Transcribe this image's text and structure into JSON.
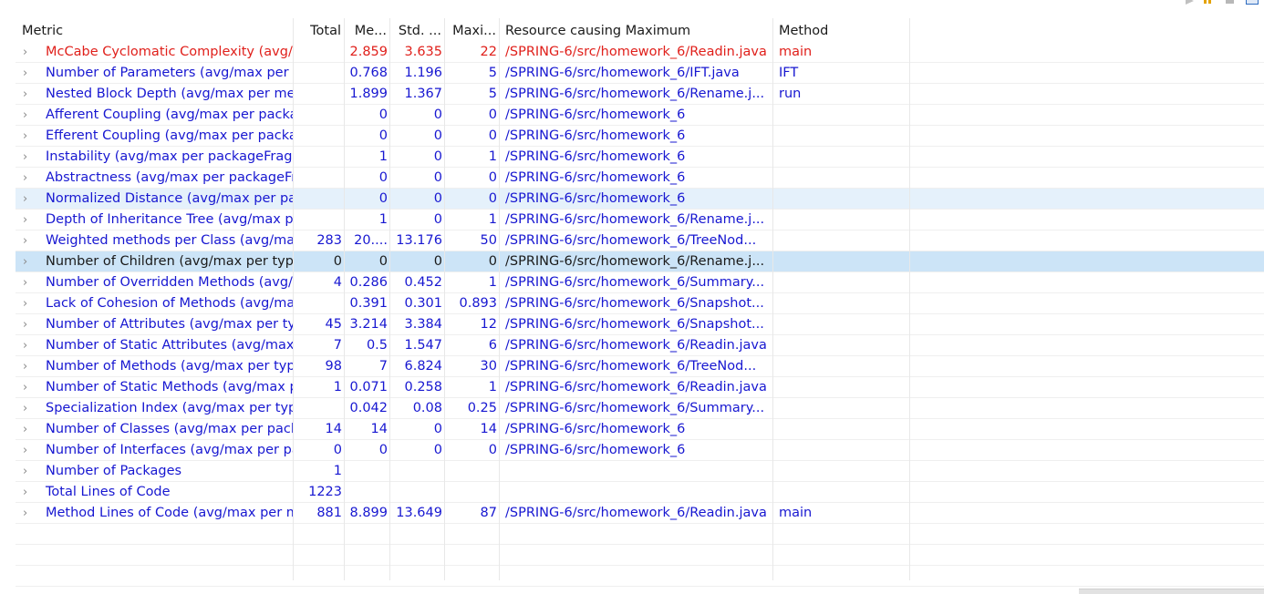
{
  "columns": {
    "metric": "Metric",
    "total": "Total",
    "mean": "Me...",
    "std": "Std. ...",
    "max": "Maxi...",
    "resource": "Resource causing Maximum",
    "method": "Method"
  },
  "colors": {
    "link": "#1717d1",
    "error": "#e0201b",
    "hover_row": "#e5f1fb",
    "selected_row": "#cce4f7"
  },
  "rows": [
    {
      "metric": "McCabe Cyclomatic Complexity (avg/max per method)",
      "total": "",
      "mean": "2.859",
      "std": "3.635",
      "max": "22",
      "resource": "/SPRING-6/src/homework_6/Readin.java",
      "method": "main"
    },
    {
      "metric": "Number of Parameters (avg/max per method)",
      "total": "",
      "mean": "0.768",
      "std": "1.196",
      "max": "5",
      "resource": "/SPRING-6/src/homework_6/IFT.java",
      "method": "IFT"
    },
    {
      "metric": "Nested Block Depth (avg/max per method)",
      "total": "",
      "mean": "1.899",
      "std": "1.367",
      "max": "5",
      "resource": "/SPRING-6/src/homework_6/Rename.j...",
      "method": "run"
    },
    {
      "metric": "Afferent Coupling (avg/max per packageFragment)",
      "total": "",
      "mean": "0",
      "std": "0",
      "max": "0",
      "resource": "/SPRING-6/src/homework_6",
      "method": ""
    },
    {
      "metric": "Efferent Coupling (avg/max per packageFragment)",
      "total": "",
      "mean": "0",
      "std": "0",
      "max": "0",
      "resource": "/SPRING-6/src/homework_6",
      "method": ""
    },
    {
      "metric": "Instability (avg/max per packageFragment)",
      "total": "",
      "mean": "1",
      "std": "0",
      "max": "1",
      "resource": "/SPRING-6/src/homework_6",
      "method": ""
    },
    {
      "metric": "Abstractness (avg/max per packageFragment)",
      "total": "",
      "mean": "0",
      "std": "0",
      "max": "0",
      "resource": "/SPRING-6/src/homework_6",
      "method": ""
    },
    {
      "metric": "Normalized Distance (avg/max per packageFragment)",
      "total": "",
      "mean": "0",
      "std": "0",
      "max": "0",
      "resource": "/SPRING-6/src/homework_6",
      "method": ""
    },
    {
      "metric": "Depth of Inheritance Tree (avg/max per type)",
      "total": "",
      "mean": "1",
      "std": "0",
      "max": "1",
      "resource": "/SPRING-6/src/homework_6/Rename.j...",
      "method": ""
    },
    {
      "metric": "Weighted methods per Class (avg/max per type)",
      "total": "283",
      "mean": "20....",
      "std": "13.176",
      "max": "50",
      "resource": "/SPRING-6/src/homework_6/TreeNod...",
      "method": ""
    },
    {
      "metric": "Number of Children (avg/max per type)",
      "total": "0",
      "mean": "0",
      "std": "0",
      "max": "0",
      "resource": "/SPRING-6/src/homework_6/Rename.j...",
      "method": ""
    },
    {
      "metric": "Number of Overridden Methods (avg/max per type)",
      "total": "4",
      "mean": "0.286",
      "std": "0.452",
      "max": "1",
      "resource": "/SPRING-6/src/homework_6/Summary...",
      "method": ""
    },
    {
      "metric": "Lack of Cohesion of Methods (avg/max per type)",
      "total": "",
      "mean": "0.391",
      "std": "0.301",
      "max": "0.893",
      "resource": "/SPRING-6/src/homework_6/Snapshot...",
      "method": ""
    },
    {
      "metric": "Number of Attributes (avg/max per type)",
      "total": "45",
      "mean": "3.214",
      "std": "3.384",
      "max": "12",
      "resource": "/SPRING-6/src/homework_6/Snapshot...",
      "method": ""
    },
    {
      "metric": "Number of Static Attributes (avg/max per type)",
      "total": "7",
      "mean": "0.5",
      "std": "1.547",
      "max": "6",
      "resource": "/SPRING-6/src/homework_6/Readin.java",
      "method": ""
    },
    {
      "metric": "Number of Methods (avg/max per type)",
      "total": "98",
      "mean": "7",
      "std": "6.824",
      "max": "30",
      "resource": "/SPRING-6/src/homework_6/TreeNod...",
      "method": ""
    },
    {
      "metric": "Number of Static Methods (avg/max per type)",
      "total": "1",
      "mean": "0.071",
      "std": "0.258",
      "max": "1",
      "resource": "/SPRING-6/src/homework_6/Readin.java",
      "method": ""
    },
    {
      "metric": "Specialization Index (avg/max per type)",
      "total": "",
      "mean": "0.042",
      "std": "0.08",
      "max": "0.25",
      "resource": "/SPRING-6/src/homework_6/Summary...",
      "method": ""
    },
    {
      "metric": "Number of Classes (avg/max per packageFragment)",
      "total": "14",
      "mean": "14",
      "std": "0",
      "max": "14",
      "resource": "/SPRING-6/src/homework_6",
      "method": ""
    },
    {
      "metric": "Number of Interfaces (avg/max per packageFragment)",
      "total": "0",
      "mean": "0",
      "std": "0",
      "max": "0",
      "resource": "/SPRING-6/src/homework_6",
      "method": ""
    },
    {
      "metric": "Number of Packages",
      "total": "1",
      "mean": "",
      "std": "",
      "max": "",
      "resource": "",
      "method": ""
    },
    {
      "metric": "Total Lines of Code",
      "total": "1223",
      "mean": "",
      "std": "",
      "max": "",
      "resource": "",
      "method": ""
    },
    {
      "metric": "Method Lines of Code (avg/max per method)",
      "total": "881",
      "mean": "8.899",
      "std": "13.649",
      "max": "87",
      "resource": "/SPRING-6/src/homework_6/Readin.java",
      "method": "main"
    }
  ]
}
